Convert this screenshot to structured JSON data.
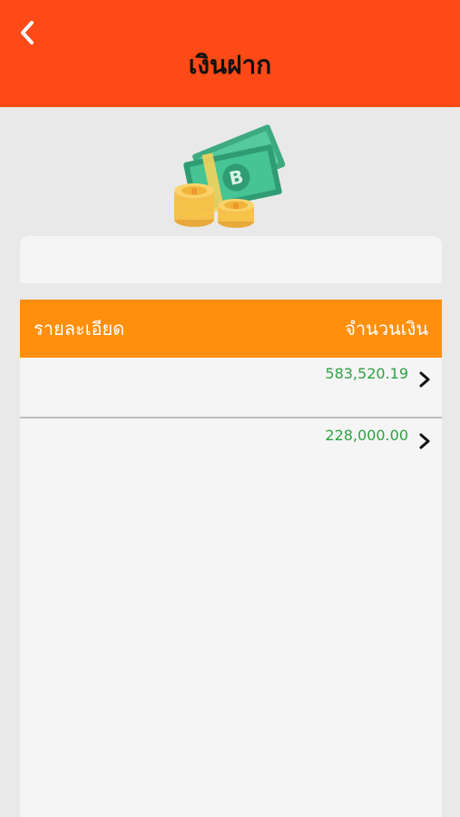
{
  "header": {
    "title": "เงินฝาก",
    "back_icon": "chevron-left-icon",
    "color": "#fe4a17"
  },
  "illustration": {
    "icon": "money-bitcoin-illustration",
    "note_color": "#46c494",
    "coin_color": "#f7c44a"
  },
  "table": {
    "header_color": "#ff8f0c",
    "col_detail": "รายละเอียด",
    "col_amount": "จำนวนเงิน",
    "rows": [
      {
        "amount": "583,520.19",
        "chevron_icon": "chevron-right-icon"
      },
      {
        "amount": "228,000.00",
        "chevron_icon": "chevron-right-icon"
      }
    ],
    "amount_color": "#2fa144"
  }
}
